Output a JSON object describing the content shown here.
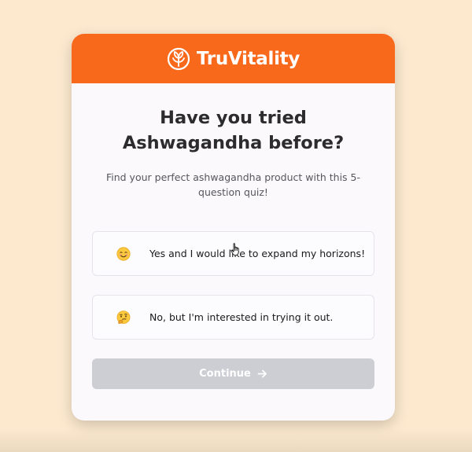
{
  "brand": {
    "name": "TruVitality",
    "logo_icon": "leaf-in-circle-icon",
    "header_color": "#f9691c"
  },
  "quiz": {
    "title": "Have you tried Ashwagandha before?",
    "subtitle": "Find your perfect ashwagandha product with this 5-question quiz!",
    "options": [
      {
        "emoji": "smiling-face-emoji",
        "label": "Yes and I would like to expand my horizons!"
      },
      {
        "emoji": "thinking-face-emoji",
        "label": "No, but I'm interested in trying it out."
      }
    ],
    "continue_label": "Continue",
    "continue_state": "disabled"
  },
  "colors": {
    "page_background": "#fce9ce",
    "card_background": "#fbf9fc",
    "button_disabled": "#ccced4"
  }
}
